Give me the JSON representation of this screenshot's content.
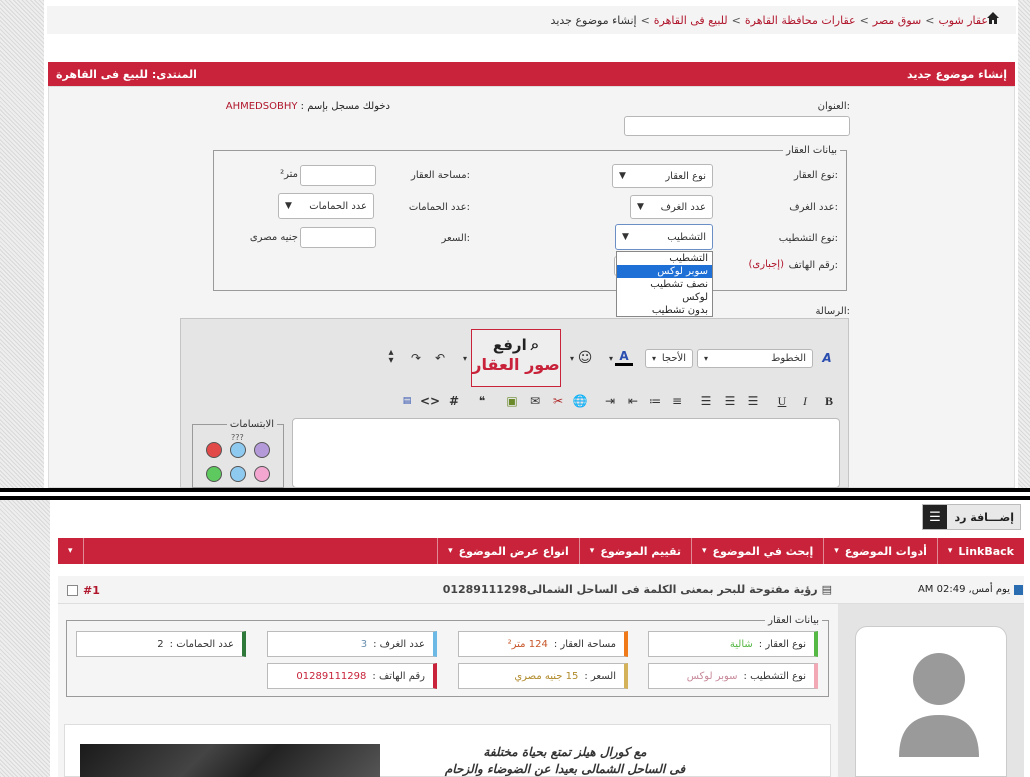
{
  "breadcrumb": {
    "items": [
      "عقار شوب",
      "سوق مصر",
      "عقارات محافظة القاهرة",
      "للبيع فى القاهرة",
      "إنشاء موضوع جديد"
    ],
    "sep": ">"
  },
  "form_header": {
    "title": "إنشاء موضوع جديد",
    "forum": "المنتدى: للبيع فى القاهرة"
  },
  "form": {
    "title_label": "العنوان:",
    "logged_in": "دخولك مسجل بإسم :",
    "username": "AHMEDSOBHY",
    "fieldset_legend": "بيانات العقار",
    "type_label": "نوع العقار:",
    "type_value": "نوع العقار",
    "area_label": "مساحة العقار:",
    "area_unit": "متر²",
    "rooms_label": "عدد الغرف:",
    "rooms_value": "عدد الغرف",
    "baths_label": "عدد الحمامات:",
    "baths_value": "عدد الحمامات",
    "finish_label": "نوع التشطيب:",
    "finish_value": "التشطيب",
    "finish_options": [
      "التشطيب",
      "سوبر لوكس",
      "نصف تشطيب",
      "لوكس",
      "بدون تشطيب"
    ],
    "finish_selected_index": 1,
    "price_label": "السعر:",
    "price_unit": "جنيه مصرى",
    "phone_label": "رقم الهاتف:",
    "phone_required": "(إجبارى)",
    "message_label": "الرسالة:"
  },
  "editor": {
    "font_label": "الخطوط",
    "size_label": "الأحجا",
    "upload_banner_top": "ارفع",
    "upload_banner_bottom": "صور العقار",
    "smilies_legend": "الابتسامات",
    "smile_marker": "???"
  },
  "thread": {
    "reply_button": "إضـــافة رد",
    "nav": [
      "LinkBack",
      "أدوات الموضوع",
      "إبحث في الموضوع",
      "تقييم الموضوع",
      "انواع عرض الموضوع"
    ],
    "post_date": "يوم أمس, 02:49 AM",
    "post_title": "رؤية مفتوحة للبحر بمعنى الكلمة فى الساحل الشمالى01289111298",
    "post_number": "#1",
    "details_legend": "بيانات العقار",
    "details": [
      {
        "label": "نوع العقار :",
        "value": "شالية",
        "bar": "#56b845",
        "vcolor": "#56b845"
      },
      {
        "label": "مساحة العقار :",
        "value": "124 متر²",
        "bar": "#f07a1a",
        "vcolor": "#c8562a"
      },
      {
        "label": "عدد الغرف :",
        "value": "3",
        "bar": "#6db9e6",
        "vcolor": "#6a8fb0"
      },
      {
        "label": "عدد الحمامات :",
        "value": "2",
        "bar": "#2f7a3a",
        "vcolor": "#333333"
      },
      {
        "label": "نوع التشطيب :",
        "value": "سوبر لوكس",
        "bar": "#f3a9b5",
        "vcolor": "#c8899a"
      },
      {
        "label": "السعر :",
        "value": "15 جنيه مصري",
        "bar": "#d4b25a",
        "vcolor": "#b08a2a"
      },
      {
        "label": "رقم الهاتف :",
        "value": "01289111298",
        "bar": "#c8233a",
        "vcolor": "#c8233a"
      }
    ],
    "post_text_1": "مع كورال هيلز تمتع بحياة مختلفة",
    "post_text_2": "فى الساحل الشمالى بعيدا عن الضوضاء والزحام"
  },
  "colors": {
    "accent": "#c8233a"
  }
}
